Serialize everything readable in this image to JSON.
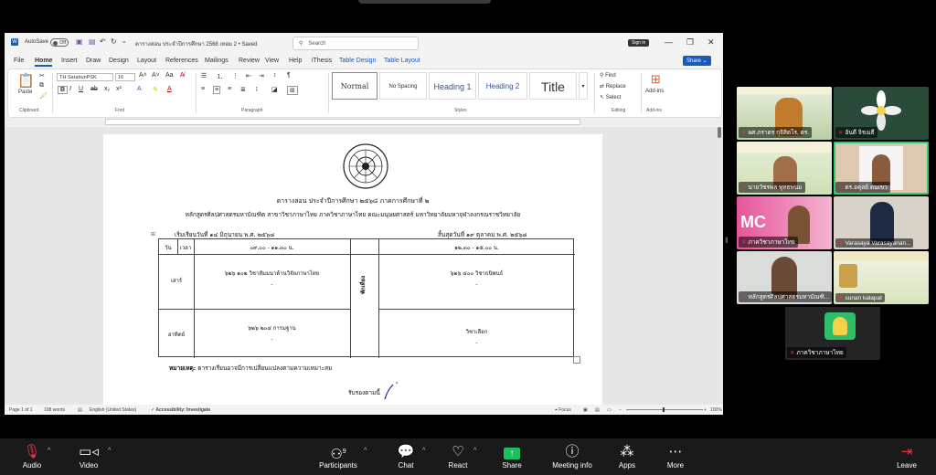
{
  "word": {
    "autosave_label": "AutoSave",
    "autosave_state": "Off",
    "doc_title": "ตารางสอน ประจำปีการศึกษา 2568 เทอม 2 • Saved",
    "search_placeholder": "Search",
    "signin_label": "Sign in",
    "menu": [
      "File",
      "Home",
      "Insert",
      "Draw",
      "Design",
      "Layout",
      "References",
      "Mailings",
      "Review",
      "View",
      "Help",
      "iThesis",
      "Table Design",
      "Table Layout"
    ],
    "share_label": "Share",
    "ribbon": {
      "paste_label": "Paste",
      "font_name": "TH SarabunPSK",
      "font_size": "16",
      "styles": [
        "Normal",
        "No Spacing",
        "Heading 1",
        "Heading 2",
        "Title"
      ],
      "find_label": "Find",
      "replace_label": "Replace",
      "select_label": "Select",
      "addins_label": "Add-ins",
      "group_labels": [
        "Clipboard",
        "Font",
        "Paragraph",
        "Styles",
        "Editing",
        "Add-ins"
      ]
    },
    "status": {
      "page": "Page 1 of 1",
      "words": "108 words",
      "language": "English (United States)",
      "accessibility": "Accessibility: Investigate",
      "focus": "Focus",
      "zoom": "100%"
    }
  },
  "document": {
    "title": "ตารางสอน ประจำปีการศึกษา ๒๕๖๘ ภาคการศึกษาที่ ๒",
    "subtitle": "หลักสูตรศิลปศาสตรมหาบัณฑิต สาขาวิชาภาษาไทย ภาควิชาภาษาไทย คณะมนุษยศาสตร์ มหาวิทยาลัยมหาจุฬาลงกรณราชวิทยาลัย",
    "start_date": "เริ่มเรียนวันที่ ๑๔ มิถุนายน พ.ศ. ๒๕๖๘",
    "end_date": "สิ้นสุดวันที่ ๑๙ ตุลาคม พ.ศ. ๒๕๖๘",
    "table": {
      "col_day": "วัน",
      "col_time": "เวลา",
      "morning_time": "๐๙.๐๐ - ๑๑.๓๐ น.",
      "afternoon_time": "๑๒.๓๐ - ๑๕.๐๐ น.",
      "break_label": "พักเที่ยง",
      "rows": [
        {
          "day": "เสาร์",
          "morning": "๖๒๖ ๑๐๒ วิชาสัมมนาด้านวิจัยภาษาไทย",
          "morning_sub": "-",
          "afternoon": "๖๒๖ ๔๐๐ วิชาธนิพนธ์",
          "afternoon_sub": "-"
        },
        {
          "day": "อาทิตย์",
          "morning": "๖๒๖ ๒๐๔ การมฐาน",
          "morning_sub": "-",
          "afternoon": "วิชาเลือก",
          "afternoon_sub": "-"
        }
      ]
    },
    "note_label": "หมายเหตุ:",
    "note_text": "ตารางเรียนอาจมีการเปลี่ยนแปลงตามความเหมาะสม",
    "certify": "รับรองตามนี้"
  },
  "participants": [
    {
      "name": "ผศ.ภราดร กุจิสิตโร, ดร.",
      "muted": true
    },
    {
      "name": "อันดี จิรเมธี",
      "muted": true
    },
    {
      "name": "นายวัชรพล พุทธพนม",
      "muted": true
    },
    {
      "name": "ดร.อคุลย์ ดนเขว",
      "muted": true
    },
    {
      "name": "ภาควิชาภาษาไทย",
      "muted": true
    },
    {
      "name": "Varasaya Varasayanan...",
      "muted": true
    },
    {
      "name": "หลักสูตรศิลปศาสตรมหาบัณฑิ...",
      "muted": true
    },
    {
      "name": "sunan kalapat",
      "muted": true
    },
    {
      "name": "ภาควิชาภาษาไทย",
      "muted": true
    }
  ],
  "toolbar": {
    "audio": "Audio",
    "video": "Video",
    "participants": "Participants",
    "participants_count": "9",
    "chat": "Chat",
    "react": "React",
    "share": "Share",
    "meeting_info": "Meeting info",
    "apps": "Apps",
    "more": "More",
    "leave": "Leave"
  },
  "colors": {
    "word_blue": "#185abd",
    "share_green": "#1fbf5f",
    "active_speaker": "#2ecc71",
    "mute_red": "#e03a3a"
  }
}
